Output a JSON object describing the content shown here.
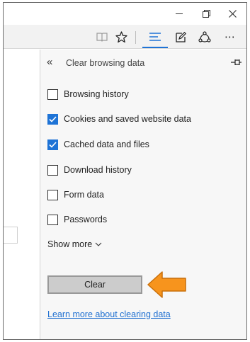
{
  "window": {
    "controls": [
      "minimize",
      "restore",
      "close"
    ]
  },
  "toolbar": {
    "more_label": "⋯"
  },
  "panel": {
    "title": "Clear browsing data",
    "options": [
      {
        "label": "Browsing history",
        "checked": false
      },
      {
        "label": "Cookies and saved website data",
        "checked": true
      },
      {
        "label": "Cached data and files",
        "checked": true
      },
      {
        "label": "Download history",
        "checked": false
      },
      {
        "label": "Form data",
        "checked": false
      },
      {
        "label": "Passwords",
        "checked": false
      }
    ],
    "show_more_label": "Show more",
    "clear_button_label": "Clear",
    "learn_more_link": "Learn more about clearing data"
  },
  "colors": {
    "accent": "#1e73d6",
    "arrow_fill": "#f7941d",
    "arrow_stroke": "#c96f0a",
    "link": "#1e6fd0"
  }
}
